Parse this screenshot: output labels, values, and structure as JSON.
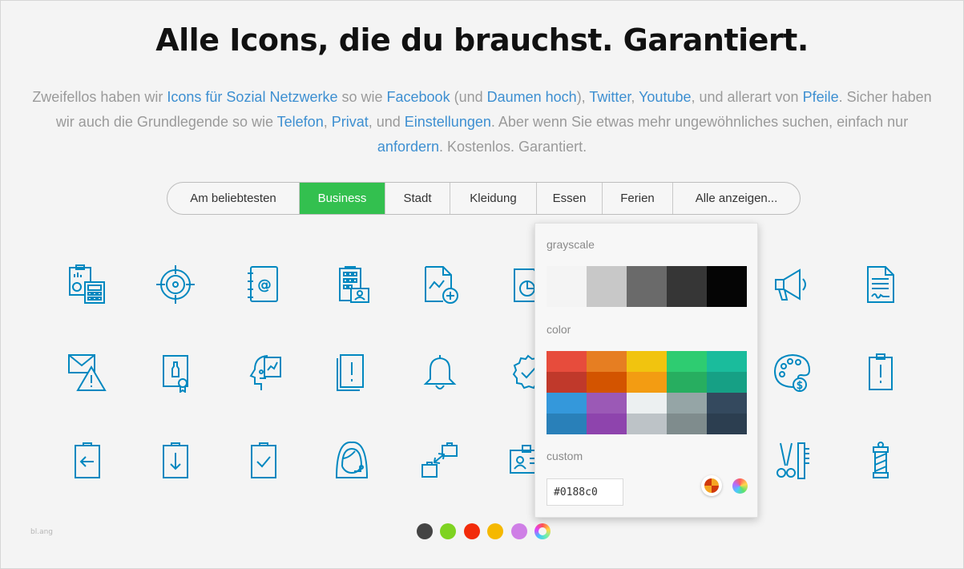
{
  "heading": "Alle Icons, die du brauchst. Garantiert.",
  "intro": {
    "t1": "Zweifellos haben wir ",
    "l1": "Icons für Sozial Netzwerke",
    "t2": " so wie ",
    "l2": "Facebook",
    "t3": " (und ",
    "l3": "Daumen hoch",
    "t4": "), ",
    "l4": "Twitter",
    "t5": ", ",
    "l5": "Youtube",
    "t6": ", und allerart von ",
    "l6": "Pfeile",
    "t7": ". Sicher haben wir auch die Grundlegende so wie ",
    "l7": "Telefon",
    "t8": ", ",
    "l8": "Privat",
    "t9": ", und ",
    "l9": "Einstellungen",
    "t10": ". Aber wenn Sie etwas mehr ungewöhnliches suchen, einfach nur ",
    "l10": "anfordern",
    "t11": ". Kostenlos. Garantiert."
  },
  "tabs": [
    {
      "label": "Am beliebtesten"
    },
    {
      "label": "Business"
    },
    {
      "label": "Stadt"
    },
    {
      "label": "Kleidung"
    },
    {
      "label": "Essen"
    },
    {
      "label": "Ferien"
    },
    {
      "label": "Alle anzeigen..."
    }
  ],
  "active_tab": "Business",
  "icon_color": "#0188c0",
  "icons": {
    "row1": [
      "report-calculator-icon",
      "target-icon",
      "address-book-icon",
      "office-building-icon",
      "document-chart-add-icon",
      "document-pie-chart-icon",
      "megaphone-icon",
      "signed-contract-icon"
    ],
    "row2": [
      "mail-warning-icon",
      "award-certificate-icon",
      "head-idea-icon",
      "important-notice-icon",
      "bell-icon",
      "verified-badge-icon",
      "palette-money-icon",
      "clipboard-alert-icon"
    ],
    "row3": [
      "clipboard-back-icon",
      "clipboard-download-icon",
      "clipboard-check-icon",
      "support-agent-icon",
      "briefcase-transfer-icon",
      "id-card-icon",
      "barber-tools-icon",
      "barber-pole-icon"
    ]
  },
  "picker": {
    "grayscale_label": "grayscale",
    "grayscale": [
      "#f4f4f4",
      "#c8c8c8",
      "#6a6a6a",
      "#363636",
      "#050505"
    ],
    "color_label": "color",
    "colors": [
      "#e74c3c",
      "#e67e22",
      "#f1c40f",
      "#2ecc71",
      "#1abc9c",
      "#c0392b",
      "#d35400",
      "#f39c12",
      "#27ae60",
      "#16a085",
      "#3498db",
      "#9b59b6",
      "#ecf0f1",
      "#95a5a6",
      "#34495e",
      "#2980b9",
      "#8e44ad",
      "#bdc3c7",
      "#7f8c8d",
      "#2c3e50"
    ],
    "custom_label": "custom",
    "custom_value": "#0188c0"
  },
  "bottom_dots": [
    "#444444",
    "#7ed321",
    "#f22b0a",
    "#f5b800",
    "#cf7fe6",
    "multicolor"
  ],
  "corner_text": "bl.ang"
}
